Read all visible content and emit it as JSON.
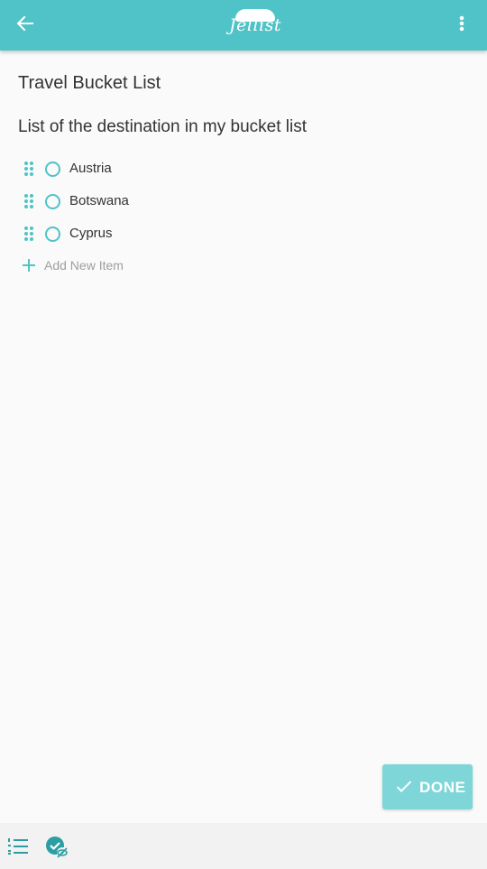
{
  "appbar": {
    "logo_text": "Jellist",
    "back_icon": "arrow-left-icon",
    "menu_icon": "more-vert-icon",
    "color": "#4fc3c7"
  },
  "list": {
    "title": "Travel Bucket List",
    "description": "List of the destination in my bucket list",
    "items": [
      {
        "label": "Austria",
        "checked": false
      },
      {
        "label": "Botswana",
        "checked": false
      },
      {
        "label": "Cyprus",
        "checked": false
      }
    ],
    "add_label": "Add New Item"
  },
  "done_button": {
    "label": "DONE",
    "color": "#7fd6d8"
  },
  "bottombar": {
    "list_icon": "numbered-list-icon",
    "hide_checked_icon": "hide-checked-icon"
  }
}
